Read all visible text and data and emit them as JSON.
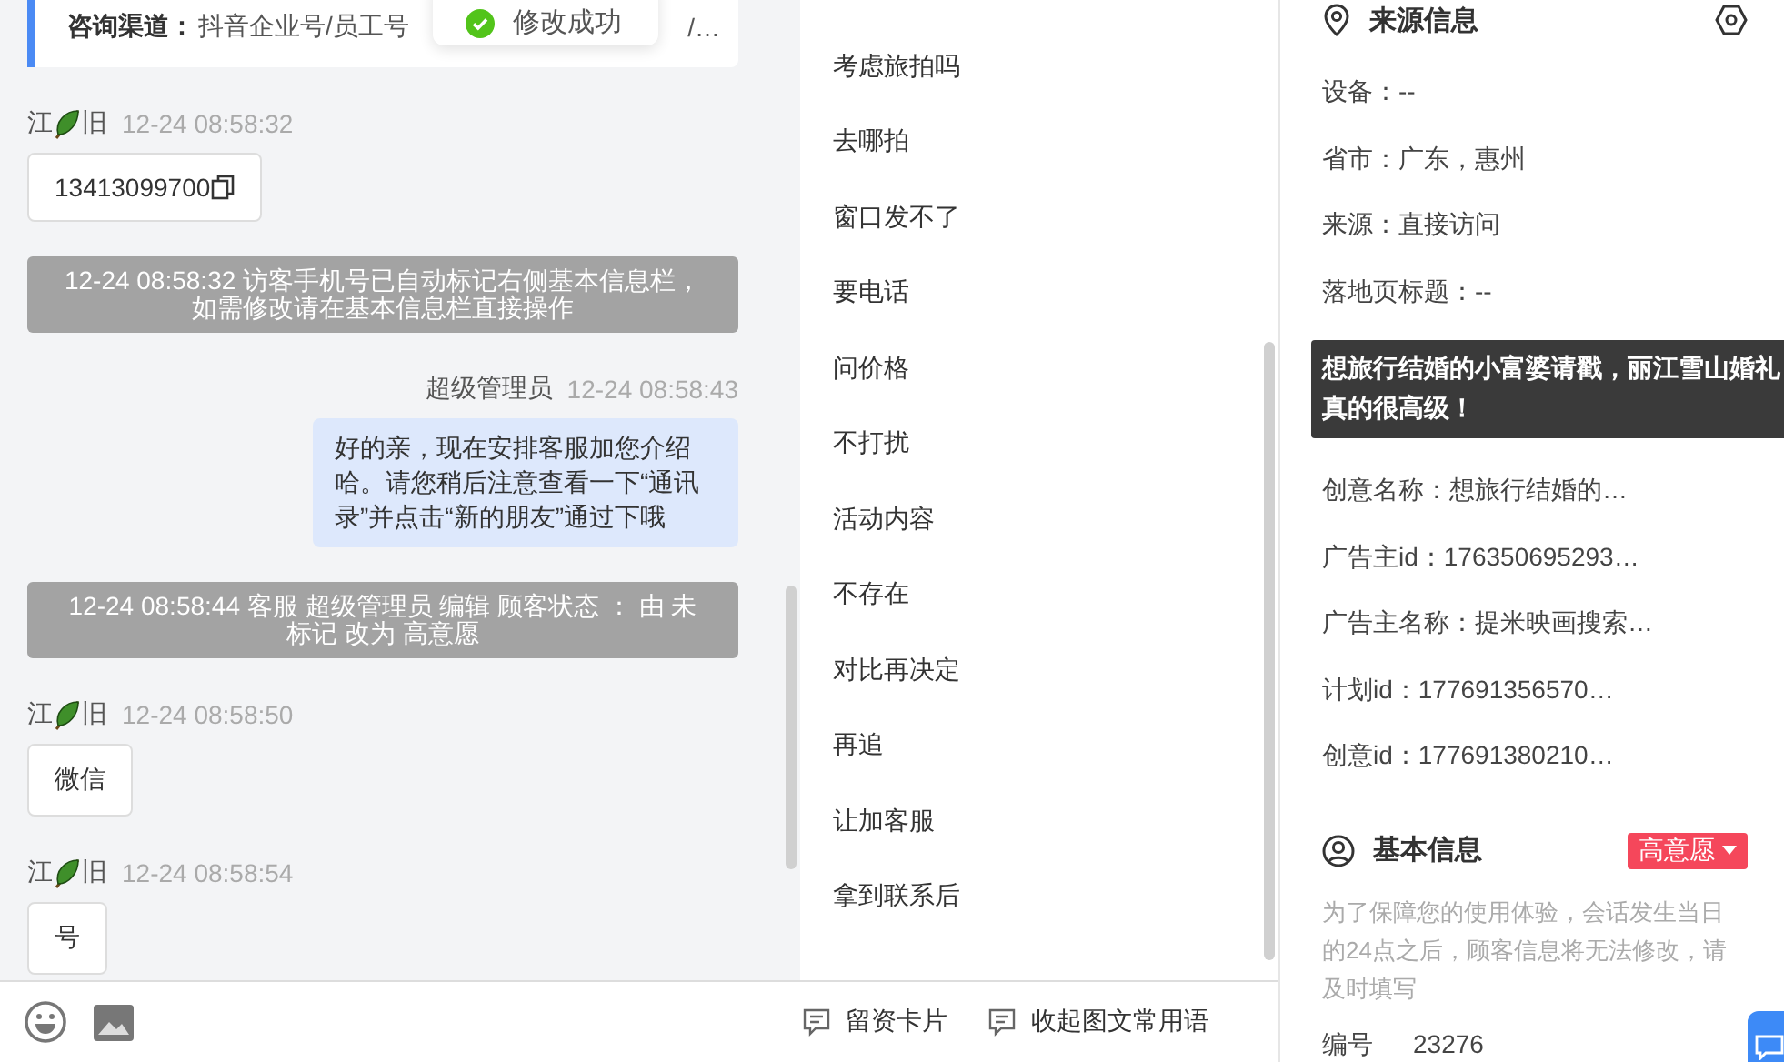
{
  "toast": {
    "text": "修改成功"
  },
  "chat": {
    "channel": {
      "label": "咨询渠道：",
      "value": "抖音企业号/员工号",
      "tail": "/…"
    },
    "messages": [
      {
        "kind": "visitor",
        "sender_before": "江",
        "sender_after": "旧",
        "time": "12-24 08:58:32",
        "text": "13413099700",
        "copyable": true
      },
      {
        "kind": "system",
        "text": "12-24 08:58:32 访客手机号已自动标记右侧基本信息栏，如需修改请在基本信息栏直接操作"
      },
      {
        "kind": "agent",
        "sender": "超级管理员",
        "time": "12-24 08:58:43",
        "text": "好的亲，现在安排客服加您介绍哈。请您稍后注意查看一下“通讯录”并点击“新的朋友”通过下哦"
      },
      {
        "kind": "system",
        "text": "12-24 08:58:44 客服 超级管理员 编辑 顾客状态 ： 由 未标记 改为 高意愿"
      },
      {
        "kind": "visitor",
        "sender_before": "江",
        "sender_after": "旧",
        "time": "12-24 08:58:50",
        "text": "微信",
        "copyable": false
      },
      {
        "kind": "visitor",
        "sender_before": "江",
        "sender_after": "旧",
        "time": "12-24 08:58:54",
        "text": "号",
        "copyable": false
      }
    ]
  },
  "phrases": {
    "items": [
      "考虑旅拍吗",
      "去哪拍",
      "窗口发不了",
      "要电话",
      "问价格",
      "不打扰",
      "活动内容",
      "不存在",
      "对比再决定",
      "再追",
      "让加客服",
      "拿到联系后"
    ],
    "actions": [
      "留资卡片",
      "收起图文常用语"
    ]
  },
  "source_info": {
    "title": "来源信息",
    "rows_before": [
      "设备：--",
      "省市：广东，惠州",
      "来源：直接访问",
      "落地页标题：--"
    ],
    "tooltip": "想旅行结婚的小富婆请戳，丽江雪山婚礼真的很高级！",
    "rows_after": [
      "创意名称：想旅行结婚的…",
      "广告主id：176350695293…",
      "广告主名称：提米映画搜索…",
      "计划id：177691356570…",
      "创意id：177691380210…"
    ]
  },
  "basic_info": {
    "title": "基本信息",
    "status": {
      "text": "高意愿",
      "color": "#f5475b"
    },
    "note": "为了保障您的使用体验，会话发生当日的24点之后，顾客信息将无法修改，请及时填写",
    "fields": [
      {
        "label": "编号",
        "value": "23276"
      }
    ]
  }
}
